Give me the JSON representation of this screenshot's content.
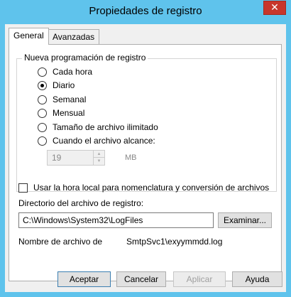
{
  "window": {
    "title": "Propiedades de registro",
    "close": "✕"
  },
  "tabs": [
    {
      "label": "General"
    },
    {
      "label": "Avanzadas"
    }
  ],
  "schedule": {
    "legend": "Nueva programación de registro",
    "options": [
      {
        "label": "Cada hora",
        "checked": false
      },
      {
        "label": "Diario",
        "checked": true
      },
      {
        "label": "Semanal",
        "checked": false
      },
      {
        "label": "Mensual",
        "checked": false
      },
      {
        "label": "Tamaño de archivo ilimitado",
        "checked": false
      },
      {
        "label": "Cuando el archivo alcance:",
        "checked": false
      }
    ],
    "size_value": "19",
    "size_unit": "MB"
  },
  "local_time": {
    "label": "Usar la hora local para nomenclatura y conversión de archivos",
    "checked": false
  },
  "directory": {
    "label": "Directorio del archivo de registro:",
    "value": "C:\\Windows\\System32\\LogFiles",
    "browse_label": "Examinar..."
  },
  "filename": {
    "label": "Nombre de archivo de",
    "value": "SmtpSvc1\\exyymmdd.log"
  },
  "buttons": {
    "accept": "Aceptar",
    "cancel": "Cancelar",
    "apply": "Aplicar",
    "help": "Ayuda"
  }
}
